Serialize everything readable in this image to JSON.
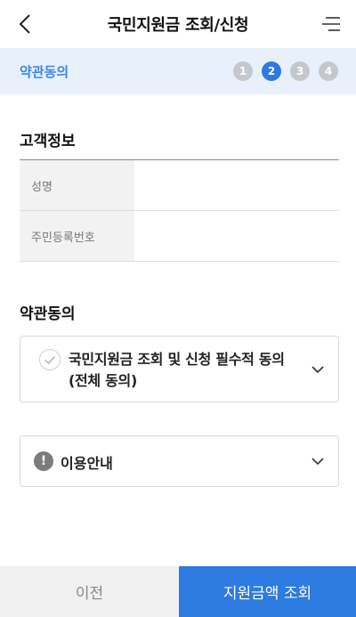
{
  "header": {
    "title": "국민지원금 조회/신청",
    "back_icon": "chevron-left-icon",
    "menu_icon": "menu-icon"
  },
  "step_bar": {
    "label": "약관동의",
    "steps": [
      "1",
      "2",
      "3",
      "4"
    ],
    "active_step": 2,
    "accent_color": "#2d7ae0"
  },
  "customer_info": {
    "heading": "고객정보",
    "rows": [
      {
        "label": "성명",
        "value": ""
      },
      {
        "label": "주민등록번호",
        "value": ""
      }
    ]
  },
  "terms": {
    "heading": "약관동의",
    "agree_item": {
      "label": "국민지원금 조회 및 신청 필수적 동의(전체 동의)",
      "checked": false
    },
    "notice_item": {
      "label": "이용안내"
    }
  },
  "bottom": {
    "prev_label": "이전",
    "next_label": "지원금액 조회"
  }
}
